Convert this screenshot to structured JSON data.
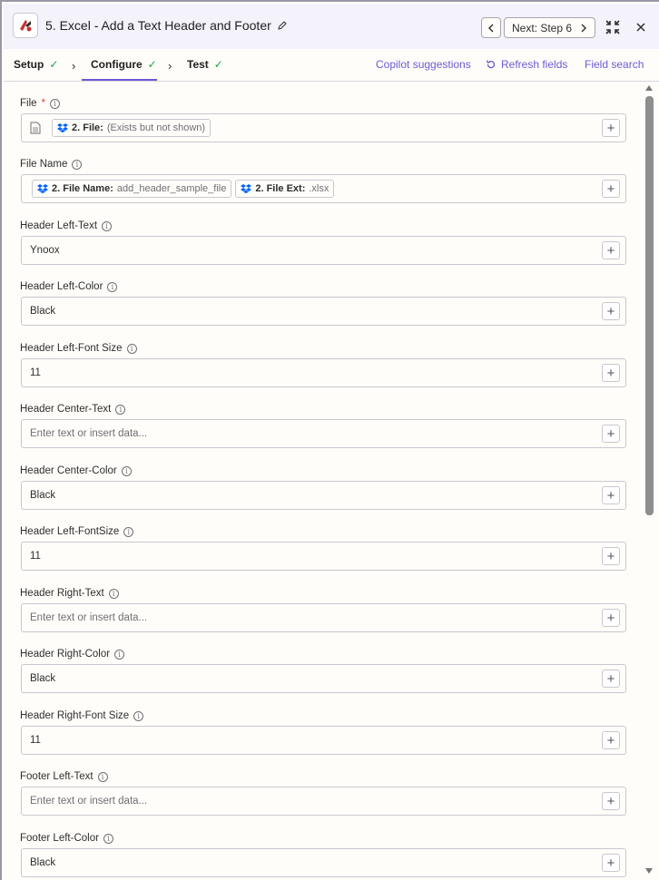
{
  "header": {
    "title": "5. Excel - Add a Text Header and Footer",
    "next_label": "Next: Step 6"
  },
  "tabs": {
    "setup": "Setup",
    "configure": "Configure",
    "test": "Test",
    "copilot": "Copilot suggestions",
    "refresh": "Refresh fields",
    "field_search": "Field search"
  },
  "fields": {
    "file": {
      "label": "File",
      "required": "*",
      "pill_key": "2. File:",
      "pill_value": "(Exists but not shown)"
    },
    "file_name": {
      "label": "File Name",
      "pill1_key": "2. File Name:",
      "pill1_value": "add_header_sample_file",
      "pill2_key": "2. File Ext:",
      "pill2_value": ".xlsx"
    },
    "header_left_text": {
      "label": "Header Left-Text",
      "value": "Ynoox"
    },
    "header_left_color": {
      "label": "Header Left-Color",
      "value": "Black"
    },
    "header_left_font_size": {
      "label": "Header Left-Font Size",
      "value": "11"
    },
    "header_center_text": {
      "label": "Header Center-Text",
      "placeholder": "Enter text or insert data..."
    },
    "header_center_color": {
      "label": "Header Center-Color",
      "value": "Black"
    },
    "header_left_fontsize2": {
      "label": "Header Left-FontSize",
      "value": "11"
    },
    "header_right_text": {
      "label": "Header Right-Text",
      "placeholder": "Enter text or insert data..."
    },
    "header_right_color": {
      "label": "Header Right-Color",
      "value": "Black"
    },
    "header_right_font_size": {
      "label": "Header Right-Font Size",
      "value": "11"
    },
    "footer_left_text": {
      "label": "Footer Left-Text",
      "placeholder": "Enter text or insert data..."
    },
    "footer_left_color": {
      "label": "Footer Left-Color",
      "value": "Black"
    }
  },
  "icons": {
    "plus": "+",
    "info": "i"
  },
  "colors": {
    "accent": "#6b5ad7",
    "success": "#17a34a",
    "dropbox": "#0061fe",
    "required": "#d64545"
  }
}
